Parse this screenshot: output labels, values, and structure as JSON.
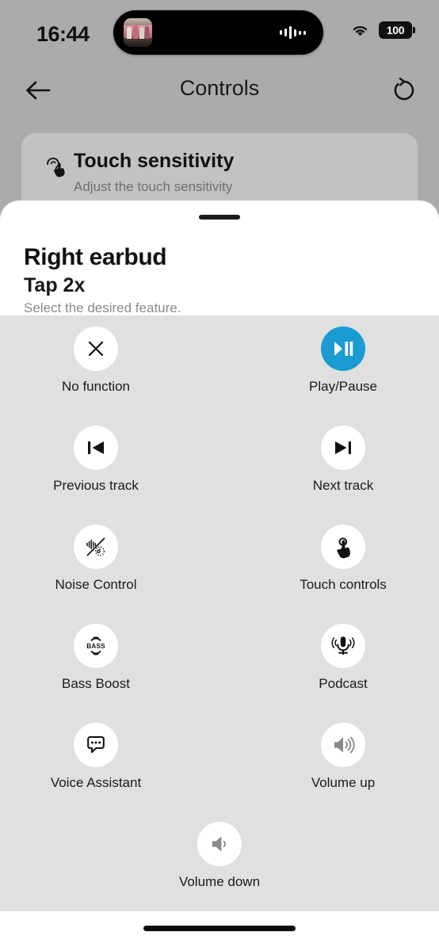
{
  "status_bar": {
    "time": "16:44",
    "battery_level": "100",
    "wifi_icon": "wifi-icon",
    "battery_icon": "battery-icon",
    "dynamic_island": {
      "album_art_icon": "album-art-thumbnail",
      "waveform_icon": "audio-waveform-icon"
    }
  },
  "nav_bar": {
    "title": "Controls",
    "back_icon": "arrow-left-icon",
    "reset_icon": "refresh-ccw-icon"
  },
  "touch_sensitivity_card": {
    "icon": "ear-touch-icon",
    "title": "Touch sensitivity",
    "subtitle": "Adjust the touch sensitivity"
  },
  "sheet": {
    "grabber": "sheet-grabber-handle",
    "title": "Right earbud",
    "subtitle": "Tap 2x",
    "hint": "Select the desired feature."
  },
  "colors": {
    "selected_accent": "#1A9BD2",
    "page_background": "#ABABAB",
    "card_background": "#C2C2C2",
    "grid_background": "#E0E0E0",
    "sheet_background": "#FFFFFF",
    "icon_active": "#111111",
    "icon_disabled": "#8A8A8A"
  },
  "options": [
    [
      {
        "label": "No function",
        "icon": "close-x-icon",
        "selected": false,
        "disabled": false
      },
      {
        "label": "Play/Pause",
        "icon": "play-pause-icon",
        "selected": true,
        "disabled": false
      }
    ],
    [
      {
        "label": "Previous track",
        "icon": "skip-previous-icon",
        "selected": false,
        "disabled": false
      },
      {
        "label": "Next track",
        "icon": "skip-next-icon",
        "selected": false,
        "disabled": false
      }
    ],
    [
      {
        "label": "Noise Control",
        "icon": "noise-control-icon",
        "selected": false,
        "disabled": false
      },
      {
        "label": "Touch controls",
        "icon": "touch-hand-icon",
        "selected": false,
        "disabled": false
      }
    ],
    [
      {
        "label": "Bass Boost",
        "icon": "bass-boost-icon",
        "selected": false,
        "disabled": false
      },
      {
        "label": "Podcast",
        "icon": "microphone-icon",
        "selected": false,
        "disabled": false
      }
    ],
    [
      {
        "label": "Voice Assistant",
        "icon": "speech-bubble-icon",
        "selected": false,
        "disabled": false
      },
      {
        "label": "Volume up",
        "icon": "volume-up-icon",
        "selected": false,
        "disabled": true
      }
    ],
    [
      {
        "label": "Volume down",
        "icon": "volume-down-icon",
        "selected": false,
        "disabled": true
      }
    ]
  ],
  "home_indicator": "home-indicator-bar"
}
